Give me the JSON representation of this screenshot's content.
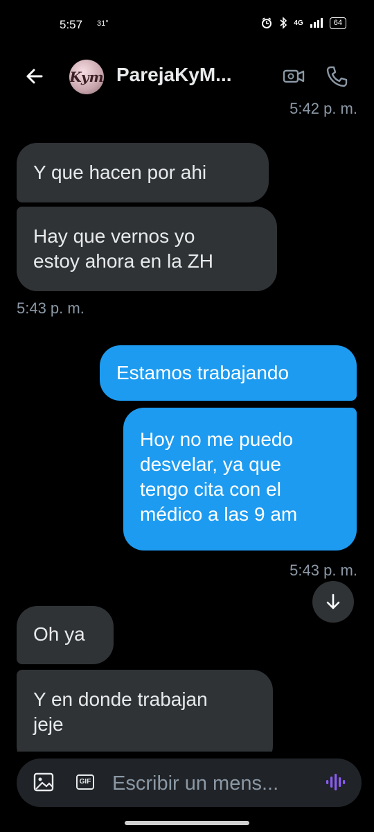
{
  "status_bar": {
    "time": "5:57",
    "temperature": "31°",
    "network": "4G",
    "battery": "64"
  },
  "header": {
    "avatar_text": "Kym",
    "title": "ParejaKyM..."
  },
  "messages": [
    {
      "direction": "in",
      "text": "5:42 p. m."
    },
    {
      "direction": "in",
      "text": "Y que hacen por ahi"
    },
    {
      "direction": "in",
      "text": "Hay que vernos yo estoy ahora en la ZH"
    },
    {
      "direction": "in",
      "text": "5:43 p. m."
    },
    {
      "direction": "out",
      "text": "Estamos trabajando"
    },
    {
      "direction": "out",
      "text": "Hoy no me puedo desvelar, ya que tengo cita con el médico a las 9 am"
    },
    {
      "direction": "out",
      "text": "5:43 p. m."
    },
    {
      "direction": "in",
      "text": "Oh ya"
    },
    {
      "direction": "in",
      "text": "Y en donde trabajan jeje"
    }
  ],
  "chat": {
    "ts_top": "5:42 p. m.",
    "msg1": "Y que hacen por ahi",
    "msg2_line1": "Hay que vernos yo",
    "msg2_line2": "estoy ahora en la ZH",
    "ts_in1": "5:43 p. m.",
    "out1": "Estamos trabajando",
    "out2_line1": "Hoy no me puedo",
    "out2_line2": "desvelar, ya que",
    "out2_line3": "tengo cita con el",
    "out2_line4": "médico a las 9 am",
    "ts_out": "5:43 p. m.",
    "msg3": "Oh ya",
    "msg4_line1": "Y en donde trabajan",
    "msg4_line2": "jeje"
  },
  "composer": {
    "placeholder": "Escribir un mens...",
    "gif_label": "GIF"
  },
  "colors": {
    "background": "#000000",
    "incoming_bubble": "#2f3336",
    "outgoing_bubble": "#1d9bf0",
    "voice_icon": "#8b5cf6"
  },
  "icons": [
    "back-arrow-icon",
    "video-call-icon",
    "phone-icon",
    "image-icon",
    "gif-icon",
    "voice-icon",
    "arrow-down-icon",
    "alarm-icon",
    "bluetooth-icon",
    "signal-icon",
    "battery-icon"
  ]
}
